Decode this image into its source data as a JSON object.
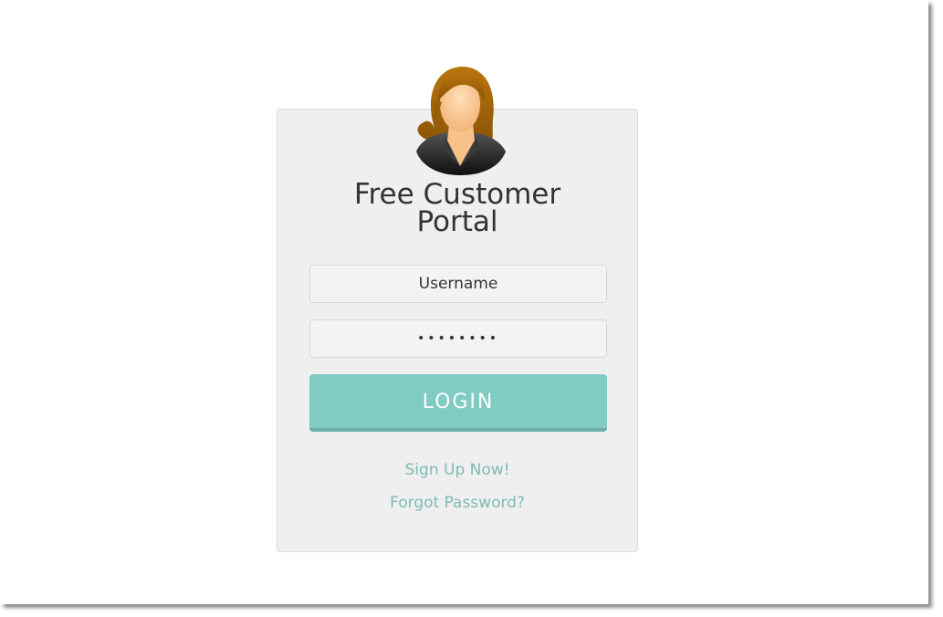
{
  "portal": {
    "title": "Free Customer Portal",
    "avatar_icon": "user-avatar-icon"
  },
  "form": {
    "username_placeholder": "Username",
    "password_value": "********",
    "login_label": "LOGIN"
  },
  "links": {
    "signup_label": "Sign Up Now!",
    "forgot_label": "Forgot Password?"
  },
  "colors": {
    "accent": "#80cbc4",
    "link": "#7fbcb4",
    "card_bg": "#efefef"
  }
}
